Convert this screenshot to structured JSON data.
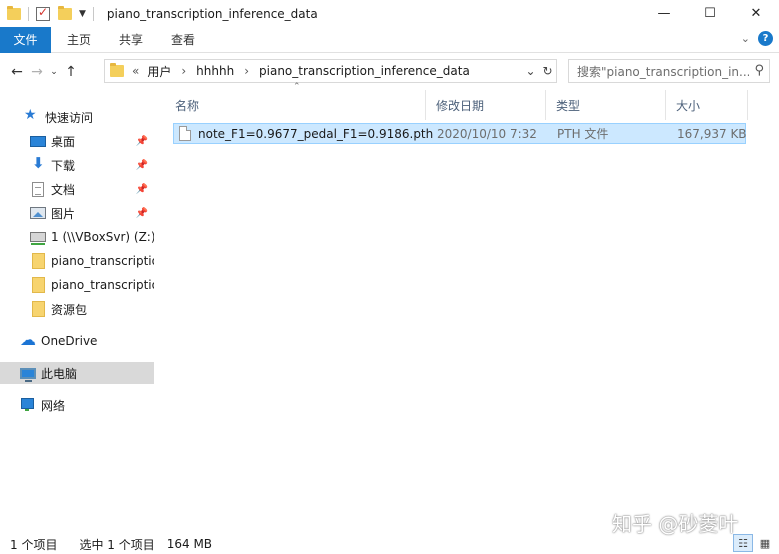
{
  "window": {
    "title": "piano_transcription_inference_data",
    "minimize": "—",
    "maximize": "☐",
    "close": "✕"
  },
  "ribbon": {
    "tabs": [
      "文件",
      "主页",
      "共享",
      "查看"
    ],
    "help": "?"
  },
  "address": {
    "overflow": "«",
    "crumbs": [
      "用户",
      "hhhhh",
      "piano_transcription_inference_data"
    ]
  },
  "search": {
    "placeholder": "搜索\"piano_transcription_in..."
  },
  "sidebar": {
    "quick_access": "快速访问",
    "items": [
      {
        "label": "桌面",
        "icon": "desktop-icon",
        "pinned": true
      },
      {
        "label": "下载",
        "icon": "download-icon",
        "pinned": true
      },
      {
        "label": "文档",
        "icon": "document-icon",
        "pinned": true
      },
      {
        "label": "图片",
        "icon": "picture-icon",
        "pinned": true
      },
      {
        "label": "1 (\\\\VBoxSvr) (Z:)",
        "icon": "network-drive-icon",
        "pinned": false
      },
      {
        "label": "piano_transcriptio",
        "icon": "folder-icon",
        "pinned": false
      },
      {
        "label": "piano_transcriptio",
        "icon": "folder-icon",
        "pinned": false
      },
      {
        "label": "资源包",
        "icon": "folder-icon",
        "pinned": false
      }
    ],
    "onedrive": "OneDrive",
    "this_pc": "此电脑",
    "network": "网络"
  },
  "columns": {
    "name": "名称",
    "date": "修改日期",
    "type": "类型",
    "size": "大小"
  },
  "files": [
    {
      "name": "note_F1=0.9677_pedal_F1=0.9186.pth",
      "date": "2020/10/10 7:32",
      "type": "PTH 文件",
      "size": "167,937 KB"
    }
  ],
  "status": {
    "count": "1 个项目",
    "selected": "选中 1 个项目",
    "size": "164 MB"
  },
  "watermark": "知乎 @砂菱叶"
}
